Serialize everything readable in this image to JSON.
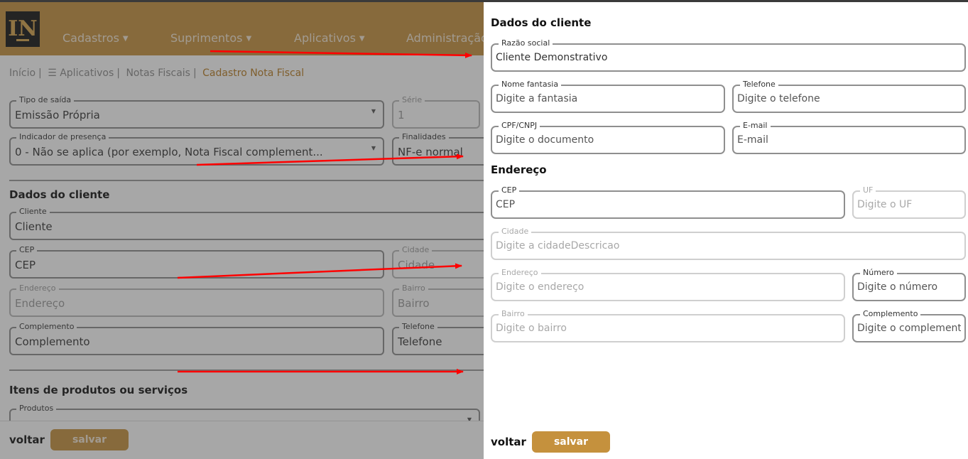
{
  "background": {
    "logo_text": "IN",
    "nav": [
      "Cadastros",
      "Suprimentos",
      "Aplicativos",
      "Administração"
    ],
    "breadcrumb": {
      "home": "Início",
      "apps": "☰ Aplicativos",
      "nf": "Notas Fiscais",
      "current": "Cadastro Nota Fiscal"
    },
    "tipo_saida": {
      "label": "Tipo de saída",
      "value": "Emissão Própria"
    },
    "serie": {
      "label": "Série",
      "value": "1"
    },
    "indicador": {
      "label": "Indicador de presença",
      "value": "0 - Não se aplica (por exemplo, Nota Fiscal complement..."
    },
    "finalidades": {
      "label": "Finalidades",
      "value": "NF-e normal"
    },
    "section_cliente": "Dados do cliente",
    "cliente": {
      "label": "Cliente",
      "value": "Cliente"
    },
    "cep": {
      "label": "CEP",
      "value": "CEP"
    },
    "cidade": {
      "label": "Cidade",
      "value": "Cidade"
    },
    "endereco": {
      "label": "Endereço",
      "value": "Endereço"
    },
    "bairro": {
      "label": "Bairro",
      "value": "Bairro"
    },
    "complemento": {
      "label": "Complemento",
      "value": "Complemento"
    },
    "telefone": {
      "label": "Telefone",
      "value": "Telefone"
    },
    "section_itens": "Itens de produtos ou serviços",
    "produtos": {
      "label": "Produtos"
    },
    "voltar": "voltar",
    "salvar": "salvar"
  },
  "drawer": {
    "section_cliente": "Dados do cliente",
    "razao_social": {
      "label": "Razão social",
      "value": "Cliente Demonstrativo"
    },
    "nome_fantasia": {
      "label": "Nome fantasia",
      "placeholder": "Digite a fantasia"
    },
    "telefone": {
      "label": "Telefone",
      "placeholder": "Digite o telefone"
    },
    "cpf_cnpj": {
      "label": "CPF/CNPJ",
      "placeholder": "Digite o documento"
    },
    "email": {
      "label": "E-mail",
      "placeholder": "E-mail"
    },
    "section_endereco": "Endereço",
    "cep": {
      "label": "CEP",
      "placeholder": "CEP"
    },
    "uf": {
      "label": "UF",
      "placeholder": "Digite o UF"
    },
    "cidade": {
      "label": "Cidade",
      "placeholder": "Digite a cidadeDescricao"
    },
    "endereco": {
      "label": "Endereço",
      "placeholder": "Digite o endereço"
    },
    "numero": {
      "label": "Número",
      "placeholder": "Digite o número"
    },
    "bairro": {
      "label": "Bairro",
      "placeholder": "Digite o bairro"
    },
    "complemento": {
      "label": "Complemento",
      "placeholder": "Digite o complemento"
    },
    "voltar": "voltar",
    "salvar": "salvar"
  },
  "colors": {
    "brand": "#c5913d",
    "arrow": "#ff0000"
  }
}
